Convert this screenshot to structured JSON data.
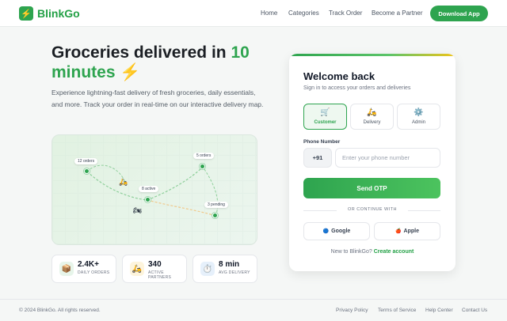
{
  "header": {
    "logo_icon": "lightning-bolt",
    "logo_glyph": "⚡",
    "brand": "BlinkGo",
    "nav": [
      "Home",
      "Categories",
      "Track Order",
      "Become a Partner"
    ],
    "cta": "Download App"
  },
  "hero": {
    "title_part1": "Groceries delivered in ",
    "title_highlight": "10",
    "title_part2": "minutes",
    "title_emoji": "⚡",
    "description": "Experience lightning-fast delivery of fresh groceries, daily essentials, and more. Track your order in real-time on our interactive delivery map."
  },
  "map": {
    "labels": [
      "12 orders",
      "5 orders",
      "8 active",
      "3 pending"
    ],
    "scooter_glyph": "🛵",
    "bike_glyph": "🏍"
  },
  "stats": [
    {
      "icon": "box-icon",
      "glyph": "📦",
      "value": "2.4K+",
      "label": "DAILY ORDERS"
    },
    {
      "icon": "scooter-icon",
      "glyph": "🛵",
      "value": "340",
      "label": "ACTIVE PARTNERS"
    },
    {
      "icon": "timer-icon",
      "glyph": "⏱️",
      "value": "8 min",
      "label": "AVG DELIVERY"
    }
  ],
  "login": {
    "title": "Welcome back",
    "subtitle": "Sign in to access your orders and deliveries",
    "roles": [
      {
        "label": "Customer",
        "glyph": "🛒",
        "icon": "cart-icon",
        "active": true
      },
      {
        "label": "Delivery",
        "glyph": "🛵",
        "icon": "scooter-icon",
        "active": false
      },
      {
        "label": "Admin",
        "glyph": "⚙️",
        "icon": "gear-icon",
        "active": false
      }
    ],
    "phone_label": "Phone Number",
    "country_code": "+91",
    "phone_placeholder": "Enter your phone number",
    "submit": "Send OTP",
    "divider": "OR CONTINUE WITH",
    "google": "Google",
    "google_glyph": "🔵",
    "apple": "Apple",
    "apple_glyph": "🍎",
    "signup_prompt": "New to BlinkGo?",
    "signup_link": "Create account"
  },
  "footer": {
    "copyright": "© 2024 BlinkGo. All rights reserved.",
    "links": [
      "Privacy Policy",
      "Terms of Service",
      "Help Center",
      "Contact Us"
    ]
  },
  "colors": {
    "accent": "#2ea44f",
    "background": "#f5f7f6"
  }
}
